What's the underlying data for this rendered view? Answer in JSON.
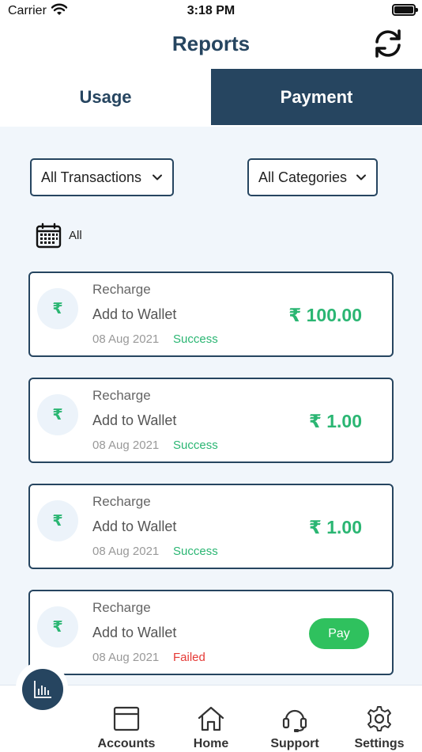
{
  "status_bar": {
    "carrier": "Carrier",
    "time": "3:18 PM"
  },
  "header": {
    "title": "Reports"
  },
  "tabs": [
    {
      "label": "Usage",
      "active": false
    },
    {
      "label": "Payment",
      "active": true
    }
  ],
  "filters": {
    "transactions": "All Transactions",
    "categories": "All Categories",
    "date": "All"
  },
  "transactions": [
    {
      "type": "Recharge",
      "description": "Add to Wallet",
      "date": "08 Aug 2021",
      "status": "Success",
      "amount": "₹ 100.00"
    },
    {
      "type": "Recharge",
      "description": "Add to Wallet",
      "date": "08 Aug 2021",
      "status": "Success",
      "amount": "₹ 1.00"
    },
    {
      "type": "Recharge",
      "description": "Add to Wallet",
      "date": "08 Aug 2021",
      "status": "Success",
      "amount": "₹ 1.00"
    },
    {
      "type": "Recharge",
      "description": "Add to Wallet",
      "date": "08 Aug 2021",
      "status": "Failed",
      "action": "Pay"
    }
  ],
  "currency_symbol": "₹",
  "tabbar": {
    "items": [
      {
        "label": "Accounts",
        "icon": "accounts-icon"
      },
      {
        "label": "Home",
        "icon": "home-icon"
      },
      {
        "label": "Support",
        "icon": "headset-icon"
      },
      {
        "label": "Settings",
        "icon": "gear-icon"
      }
    ],
    "fab_icon": "bar-chart-icon"
  },
  "colors": {
    "primary": "#264560",
    "success": "#2bb673",
    "failed": "#e53935",
    "pay_button": "#2fc15e",
    "background": "#f1f6fb"
  }
}
